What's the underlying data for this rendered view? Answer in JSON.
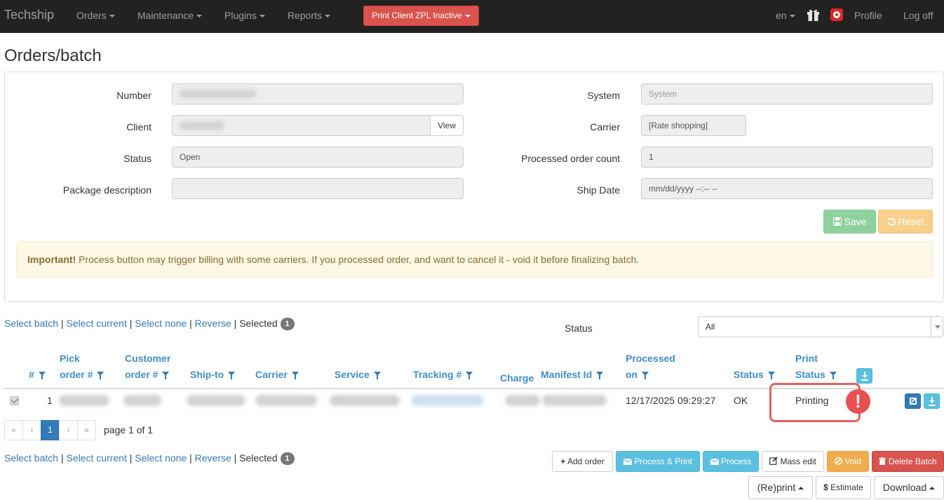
{
  "navbar": {
    "brand": "Techship",
    "menu": [
      "Orders",
      "Maintenance",
      "Plugins",
      "Reports"
    ],
    "zpl_button": "Print Client ZPL Inactive",
    "language": "en",
    "profile": "Profile",
    "logoff": "Log off"
  },
  "page": {
    "title": "Orders/batch"
  },
  "form": {
    "number_label": "Number",
    "client_label": "Client",
    "client_view": "View",
    "status_label": "Status",
    "status_value": "Open",
    "package_label": "Package description",
    "system_label": "System",
    "system_placeholder": "System",
    "carrier_label": "Carrier",
    "carrier_value": "[Rate shopping]",
    "processed_label": "Processed order count",
    "processed_value": "1",
    "shipdate_label": "Ship Date",
    "shipdate_placeholder": "mm/dd/yyyy  --:-- --",
    "save": "Save",
    "reset": "Reset"
  },
  "alert": {
    "strong": "Important!",
    "text": " Process button may trigger billing with some carriers. If you processed order, and want to cancel it - void it before finalizing batch."
  },
  "selection": {
    "select_batch": "Select batch",
    "select_current": "Select current",
    "select_none": "Select none",
    "reverse": "Reverse",
    "selected": "Selected",
    "count": "1",
    "sep": " | "
  },
  "filter": {
    "status_label": "Status",
    "status_value": "All"
  },
  "table": {
    "headers": {
      "num": "#",
      "pick_1": "Pick",
      "pick_2": "order #",
      "cust_1": "Customer",
      "cust_2": "order #",
      "shipto": "Ship-to",
      "carrier": "Carrier",
      "service": "Service",
      "tracking": "Tracking #",
      "charge": "Charge",
      "manifest": "Manifest Id",
      "processed_1": "Processed",
      "processed_2": "on",
      "status": "Status",
      "print_1": "Print",
      "print_2": "Status"
    },
    "rows": [
      {
        "num": "1",
        "processed_on": "12/17/2025 09:29:27",
        "status": "OK",
        "print_status": "Printing"
      }
    ]
  },
  "pagination": {
    "first": "«",
    "prev": "‹",
    "current": "1",
    "next": "›",
    "last": "»",
    "info": "page 1 of 1"
  },
  "actions": {
    "add_order": "Add order",
    "process_print": "Process & Print",
    "process": "Process",
    "mass_edit": "Mass edit",
    "void": "Void",
    "delete_batch": "Delete Batch",
    "reprint": "(Re)print",
    "estimate": "Estimate",
    "download": "Download"
  },
  "warning_glyph": "!",
  "colors": {
    "navbar": "#222222",
    "danger": "#d9534f",
    "info": "#5bc0de",
    "warning": "#f0ad4e",
    "primary": "#337ab7",
    "highlight": "#e06262"
  },
  "icons": [
    "gift-icon",
    "app-logo-icon",
    "filter-icon",
    "download-icon",
    "edit-icon",
    "save-icon",
    "reset-icon",
    "plus-icon",
    "envelope-icon",
    "pencil-square-icon",
    "ban-icon",
    "trash-icon",
    "dollar-icon",
    "exclamation-icon"
  ]
}
